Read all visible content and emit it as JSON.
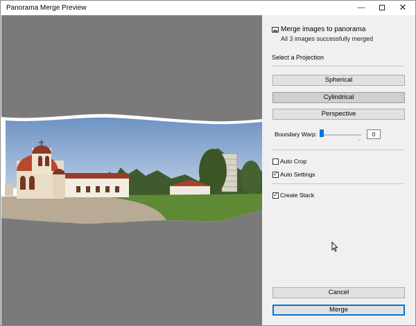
{
  "window": {
    "title": "Panorama Merge Preview",
    "minimize_glyph": "—",
    "close_glyph": "✕"
  },
  "header": {
    "icon": "panorama-icon",
    "title": "Merge images to panorama",
    "subtitle": "All 3 images successfully merged"
  },
  "projection": {
    "label": "Select a Projection",
    "options": [
      {
        "label": "Spherical",
        "selected": false
      },
      {
        "label": "Cylindrical",
        "selected": true
      },
      {
        "label": "Perspective",
        "selected": false
      }
    ]
  },
  "boundary_warp": {
    "label": "Boundary Warp:",
    "value": "0"
  },
  "checkboxes": {
    "auto_crop": {
      "label": "Auto Crop",
      "checked": false
    },
    "auto_settings": {
      "label": "Auto Settings",
      "checked": true
    },
    "create_stack": {
      "label": "Create Stack",
      "checked": true
    }
  },
  "actions": {
    "cancel": "Cancel",
    "merge": "Merge"
  },
  "colors": {
    "accent": "#0078d7",
    "preview_bg": "#7a7a7a",
    "panel_bg": "#f0f0f0"
  }
}
